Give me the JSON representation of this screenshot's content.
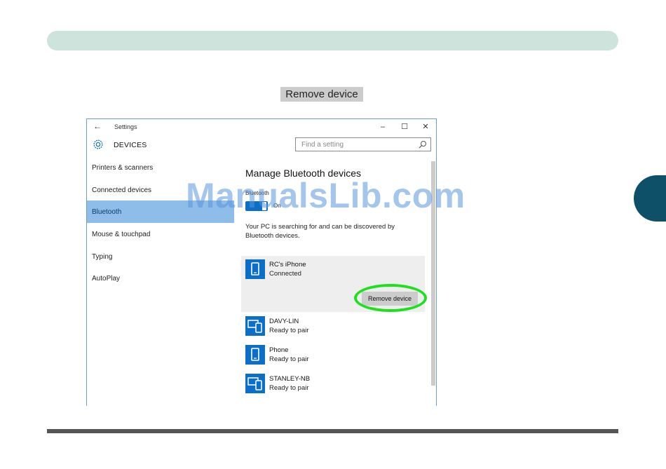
{
  "caption": {
    "label": "Remove device"
  },
  "window": {
    "title": "Settings",
    "section_title": "DEVICES",
    "search_placeholder": "Find a setting",
    "controls": {
      "minimize": "–",
      "maximize": "☐",
      "close": "✕"
    }
  },
  "sidebar": {
    "items": [
      {
        "label": "Printers & scanners",
        "active": false
      },
      {
        "label": "Connected devices",
        "active": false
      },
      {
        "label": "Bluetooth",
        "active": true
      },
      {
        "label": "Mouse & touchpad",
        "active": false
      },
      {
        "label": "Typing",
        "active": false
      },
      {
        "label": "AutoPlay",
        "active": false
      }
    ]
  },
  "content": {
    "title": "Manage Bluetooth devices",
    "bluetooth_label": "Bluetooth",
    "bluetooth_state": "On",
    "status_text": "Your PC is searching for and can be discovered by Bluetooth devices.",
    "devices": [
      {
        "name": "RC's iPhone",
        "status": "Connected",
        "icon": "phone-icon"
      },
      {
        "name": "DAVY-LIN",
        "status": "Ready to pair",
        "icon": "computer-icon"
      },
      {
        "name": "Phone",
        "status": "Ready to pair",
        "icon": "phone-icon"
      },
      {
        "name": "STANLEY-NB",
        "status": "Ready to pair",
        "icon": "computer-icon"
      }
    ],
    "remove_button": "Remove device"
  },
  "watermark": "ManualsLib.com",
  "colors": {
    "accent": "#0b6fc8",
    "selected_nav": "#8dbde8",
    "highlight_ring": "#1fe01f",
    "header_bar": "#cfe3dd",
    "chapter_tab": "#0d5068"
  }
}
